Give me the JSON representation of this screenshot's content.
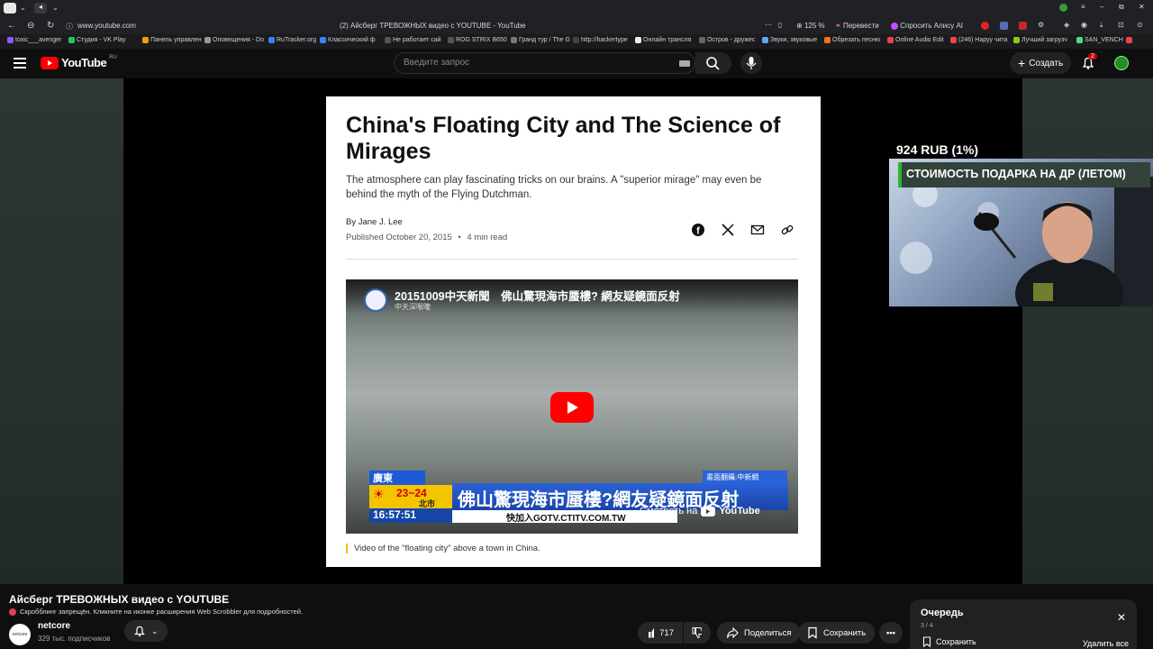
{
  "browser": {
    "url": "www.youtube.com",
    "tab_title": "(2) Айсберг ТРЕВОЖНЫХ видео с YOUTUBE - YouTube",
    "zoom": "125 %",
    "translate_label": "Перевести",
    "alice_label": "Спросить Алису AI",
    "bookmarks": [
      "toxic___avenger",
      "Студия - VK Play",
      "Панель управлен",
      "Оповещения - Do",
      "RuTracker.org",
      "Классический ф",
      "Не работает сай",
      "ROG STRIX B650",
      "Гранд тур / The G",
      "http://hackertype",
      "Онлайн трансля",
      "Остров - дружес",
      "Звуки, звуковые",
      "Обрезать песню",
      "Online Audio Edit",
      "(246) Наруу чита",
      "Лучший загрузч",
      "SAN_VENCH"
    ]
  },
  "yt": {
    "logo_text": "YouTube",
    "logo_region": "RU",
    "search_placeholder": "Введите запрос",
    "create_label": "Создать",
    "notif_count": "2"
  },
  "article": {
    "title": "China's Floating City and The Science of Mirages",
    "dek": "The atmosphere can play fascinating tricks on our brains. A \"superior mirage\" may even be behind the myth of the Flying Dutchman.",
    "byline": "By Jane J. Lee",
    "published": "Published October 20, 2015",
    "read_time": "4 min read",
    "caption": "Video of the \"floating city\" above a town in China."
  },
  "embed": {
    "title": "20151009中天新聞　佛山驚現海市蜃樓? 網友疑鏡面反射",
    "channel": "中天深喉嚨",
    "ticker_region": "廣東",
    "ticker_temp": "23~24",
    "ticker_city": "北市",
    "ticker_time": "16:57:51",
    "ticker_headline": "佛山驚現海市蜃樓?網友疑鏡面反射",
    "ticker_sub": "快加入GOTV.CTITV.COM.TW",
    "ticker_tag": "畫面翻攝:中新網",
    "watch_on": "Смотреть на",
    "watch_on_brand": "YouTube"
  },
  "overlay": {
    "donation": "924 RUB (1%)",
    "goal": "СТОИМОСТЬ ПОДАРКА НА ДР (ЛЕТОМ)"
  },
  "video": {
    "title": "Айсберг ТРЕВОЖНЫХ видео с YOUTUBE",
    "scrobbler": "Скробблинг запрещён. Кликните на иконке расширения Web Scrobbler для подробностей.",
    "channel": "netcore",
    "subscribers": "329 тыс. подписчиков",
    "likes": "717",
    "share_label": "Поделиться",
    "save_label": "Сохранить"
  },
  "queue": {
    "title": "Очередь",
    "position": "3 / 4",
    "save_label": "Сохранить",
    "remove_all": "Удалить все"
  }
}
